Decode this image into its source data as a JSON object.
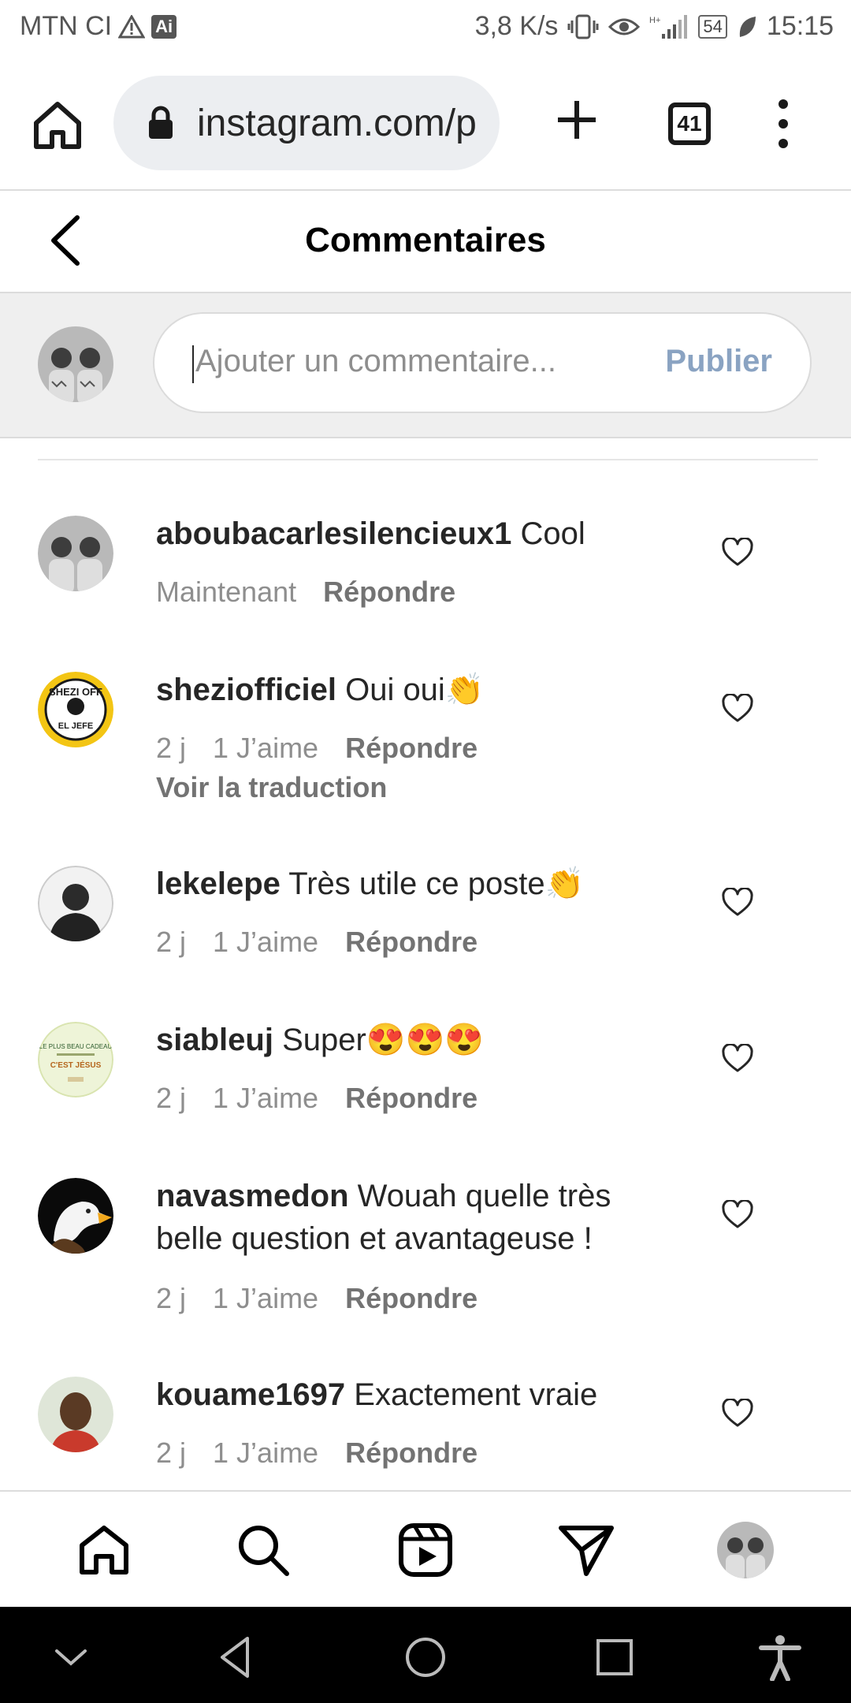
{
  "status_bar": {
    "carrier": "MTN CI",
    "ai_badge": "Ai",
    "speed": "3,8 K/s",
    "battery": "54",
    "time": "15:15"
  },
  "browser": {
    "url": "instagram.com/p",
    "tab_count": "41"
  },
  "header": {
    "title": "Commentaires"
  },
  "composer": {
    "placeholder": "Ajouter un commentaire...",
    "publish_label": "Publier"
  },
  "comments": [
    {
      "username": "aboubacarlesilencieux1",
      "text": "Cool",
      "time": "Maintenant",
      "likes": "",
      "reply_label": "Répondre",
      "translate": ""
    },
    {
      "username": "sheziofficiel",
      "text": "Oui oui👏",
      "time": "2 j",
      "likes": "1 J’aime",
      "reply_label": "Répondre",
      "translate": "Voir la traduction"
    },
    {
      "username": "lekelepe",
      "text": "Très utile ce poste👏",
      "time": "2 j",
      "likes": "1 J’aime",
      "reply_label": "Répondre",
      "translate": ""
    },
    {
      "username": "siableuj",
      "text": "Super😍😍😍",
      "time": "2 j",
      "likes": "1 J’aime",
      "reply_label": "Répondre",
      "translate": ""
    },
    {
      "username": "navasmedon",
      "text": "Wouah quelle très belle question et avantageuse !",
      "time": "2 j",
      "likes": "1 J’aime",
      "reply_label": "Répondre",
      "translate": ""
    },
    {
      "username": "kouame1697",
      "text": "Exactement vraie",
      "time": "2 j",
      "likes": "1 J’aime",
      "reply_label": "Répondre",
      "translate": ""
    }
  ],
  "avatar_texts": {
    "shezi_top": "SHEZI OFF",
    "shezi_bottom": "EL JEFE",
    "siableuj_line1": "LE PLUS BEAU CADEAU",
    "siableuj_line2": "C'EST JÉSUS"
  },
  "bottom_nav": {
    "icons": [
      "home-icon",
      "search-icon",
      "reels-icon",
      "direct-icon",
      "profile-avatar"
    ]
  },
  "colors": {
    "publish": "#8aa3c2",
    "meta": "#8e8e8e",
    "composer_bg": "#efefef"
  }
}
